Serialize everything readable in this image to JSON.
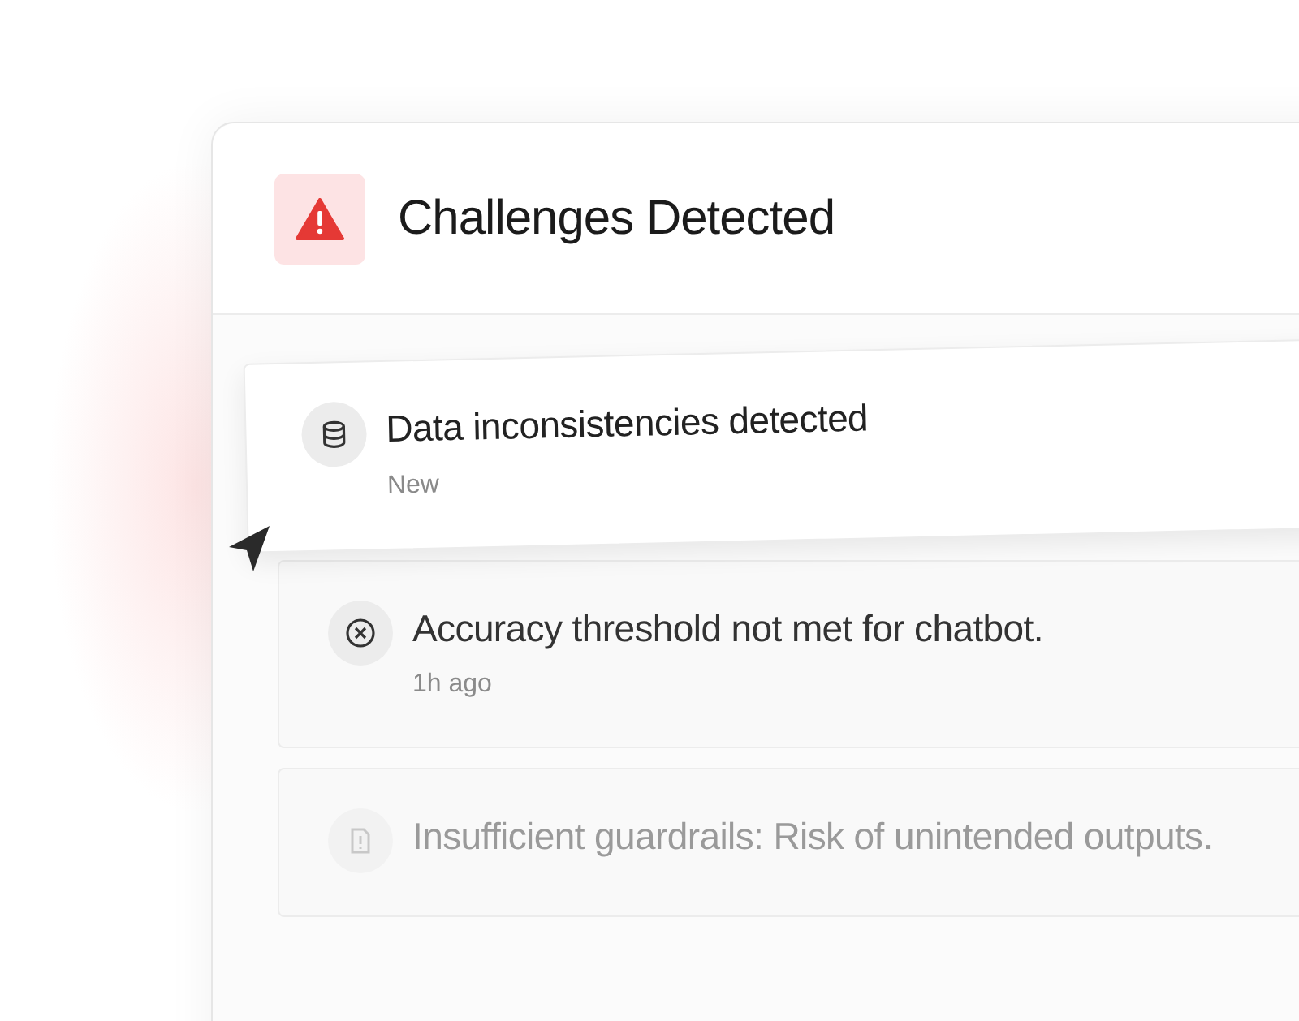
{
  "panel": {
    "title": "Challenges Detected"
  },
  "items": [
    {
      "kind": "database",
      "title": "Data inconsistencies detected",
      "time": "New",
      "selected": true
    },
    {
      "kind": "error",
      "title": "Accuracy threshold not met for chatbot.",
      "time": "1h ago",
      "selected": false
    },
    {
      "kind": "alert-file",
      "title": "Insufficient guardrails: Risk of unintended outputs.",
      "selected": false
    }
  ]
}
